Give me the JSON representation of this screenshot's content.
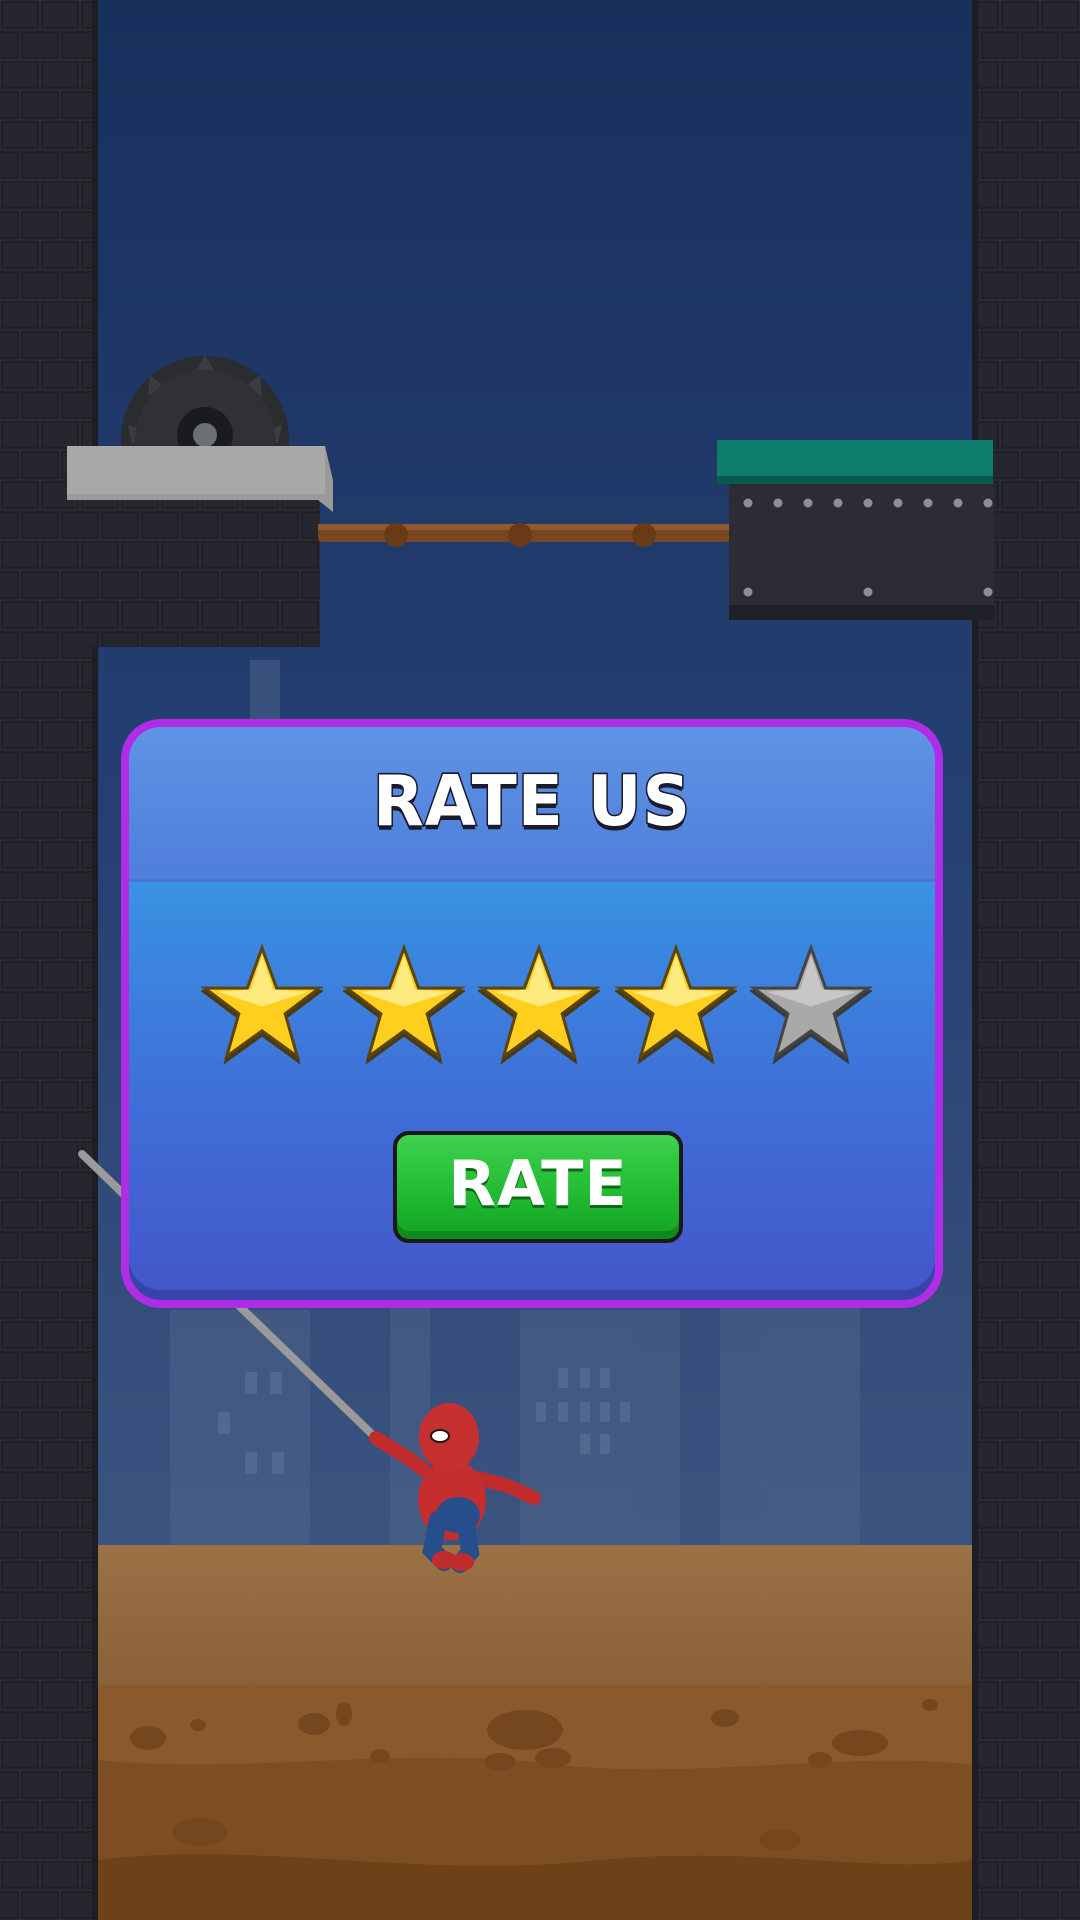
{
  "dialog": {
    "title": "RATE US",
    "rating": {
      "selected": 4,
      "max": 5
    },
    "rate_button_label": "RATE"
  },
  "colors": {
    "modal_border": "#b02de8",
    "header_bg": "#5a8fe2",
    "body_gradient_top": "#36b4ee",
    "body_gradient_bottom": "#4456c9",
    "star_filled": "#ffd21f",
    "star_empty": "#a8a8a8",
    "button_green": "#22bb33",
    "sky": "#1c3566"
  },
  "scene": {
    "icons": [
      "spinning-saw-icon",
      "spider-hero-character",
      "web-rope",
      "wooden-rope-bridge"
    ]
  }
}
